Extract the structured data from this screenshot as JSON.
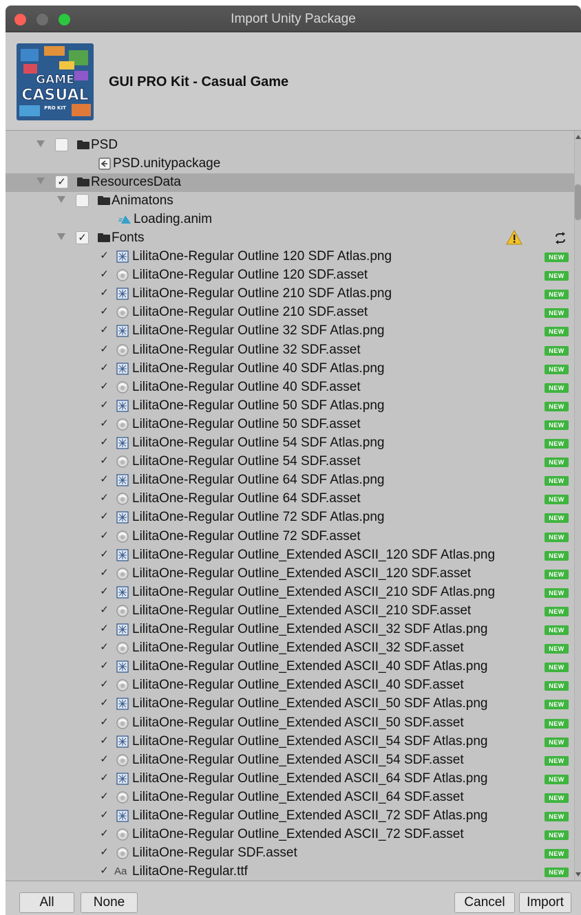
{
  "window": {
    "title": "Import Unity Package"
  },
  "package": {
    "name": "GUI PRO Kit - Casual Game",
    "logo_text": [
      "GAME",
      "CASUAL",
      "PRO KIT"
    ]
  },
  "badges": {
    "new": "NEW"
  },
  "tree": {
    "psd_folder": {
      "label": "PSD",
      "checked": false,
      "icon": "folder-icon"
    },
    "psd_package": {
      "label": "PSD.unitypackage",
      "icon": "unitypackage-icon"
    },
    "resources_folder": {
      "label": "ResourcesData",
      "checked": true,
      "icon": "folder-icon"
    },
    "animations_folder": {
      "label": "Animatons",
      "checked": false,
      "icon": "folder-icon"
    },
    "loading_anim": {
      "label": "Loading.anim",
      "icon": "animation-icon"
    },
    "fonts_folder": {
      "label": "Fonts",
      "checked": true,
      "icon": "folder-icon",
      "status_icons": [
        "warning-icon",
        "refresh-icon"
      ]
    },
    "font_files": [
      {
        "label": "LilitaOne-Regular Outline 120 SDF Atlas.png",
        "icon": "texture-icon",
        "checked": true
      },
      {
        "label": "LilitaOne-Regular Outline 120 SDF.asset",
        "icon": "asset-icon",
        "checked": true
      },
      {
        "label": "LilitaOne-Regular Outline 210 SDF Atlas.png",
        "icon": "texture-icon",
        "checked": true
      },
      {
        "label": "LilitaOne-Regular Outline 210 SDF.asset",
        "icon": "asset-icon",
        "checked": true
      },
      {
        "label": "LilitaOne-Regular Outline 32 SDF Atlas.png",
        "icon": "texture-icon",
        "checked": true
      },
      {
        "label": "LilitaOne-Regular Outline 32 SDF.asset",
        "icon": "asset-icon",
        "checked": true
      },
      {
        "label": "LilitaOne-Regular Outline 40 SDF Atlas.png",
        "icon": "texture-icon",
        "checked": true
      },
      {
        "label": "LilitaOne-Regular Outline 40 SDF.asset",
        "icon": "asset-icon",
        "checked": true
      },
      {
        "label": "LilitaOne-Regular Outline 50 SDF Atlas.png",
        "icon": "texture-icon",
        "checked": true
      },
      {
        "label": "LilitaOne-Regular Outline 50 SDF.asset",
        "icon": "asset-icon",
        "checked": true
      },
      {
        "label": "LilitaOne-Regular Outline 54 SDF Atlas.png",
        "icon": "texture-icon",
        "checked": true
      },
      {
        "label": "LilitaOne-Regular Outline 54 SDF.asset",
        "icon": "asset-icon",
        "checked": true
      },
      {
        "label": "LilitaOne-Regular Outline 64 SDF Atlas.png",
        "icon": "texture-icon",
        "checked": true
      },
      {
        "label": "LilitaOne-Regular Outline 64 SDF.asset",
        "icon": "asset-icon",
        "checked": true
      },
      {
        "label": "LilitaOne-Regular Outline 72 SDF Atlas.png",
        "icon": "texture-icon",
        "checked": true
      },
      {
        "label": "LilitaOne-Regular Outline 72 SDF.asset",
        "icon": "asset-icon",
        "checked": true
      },
      {
        "label": "LilitaOne-Regular Outline_Extended ASCII_120 SDF Atlas.png",
        "icon": "texture-icon",
        "checked": true
      },
      {
        "label": "LilitaOne-Regular Outline_Extended ASCII_120 SDF.asset",
        "icon": "asset-icon",
        "checked": true
      },
      {
        "label": "LilitaOne-Regular Outline_Extended ASCII_210 SDF Atlas.png",
        "icon": "texture-icon",
        "checked": true
      },
      {
        "label": "LilitaOne-Regular Outline_Extended ASCII_210 SDF.asset",
        "icon": "asset-icon",
        "checked": true
      },
      {
        "label": "LilitaOne-Regular Outline_Extended ASCII_32 SDF Atlas.png",
        "icon": "texture-icon",
        "checked": true
      },
      {
        "label": "LilitaOne-Regular Outline_Extended ASCII_32 SDF.asset",
        "icon": "asset-icon",
        "checked": true
      },
      {
        "label": "LilitaOne-Regular Outline_Extended ASCII_40 SDF Atlas.png",
        "icon": "texture-icon",
        "checked": true
      },
      {
        "label": "LilitaOne-Regular Outline_Extended ASCII_40 SDF.asset",
        "icon": "asset-icon",
        "checked": true
      },
      {
        "label": "LilitaOne-Regular Outline_Extended ASCII_50 SDF Atlas.png",
        "icon": "texture-icon",
        "checked": true
      },
      {
        "label": "LilitaOne-Regular Outline_Extended ASCII_50 SDF.asset",
        "icon": "asset-icon",
        "checked": true
      },
      {
        "label": "LilitaOne-Regular Outline_Extended ASCII_54 SDF Atlas.png",
        "icon": "texture-icon",
        "checked": true
      },
      {
        "label": "LilitaOne-Regular Outline_Extended ASCII_54 SDF.asset",
        "icon": "asset-icon",
        "checked": true
      },
      {
        "label": "LilitaOne-Regular Outline_Extended ASCII_64 SDF Atlas.png",
        "icon": "texture-icon",
        "checked": true
      },
      {
        "label": "LilitaOne-Regular Outline_Extended ASCII_64 SDF.asset",
        "icon": "asset-icon",
        "checked": true
      },
      {
        "label": "LilitaOne-Regular Outline_Extended ASCII_72 SDF Atlas.png",
        "icon": "texture-icon",
        "checked": true
      },
      {
        "label": "LilitaOne-Regular Outline_Extended ASCII_72 SDF.asset",
        "icon": "asset-icon",
        "checked": true
      },
      {
        "label": "LilitaOne-Regular SDF.asset",
        "icon": "asset-icon",
        "checked": true
      },
      {
        "label": "LilitaOne-Regular.ttf",
        "icon": "font-icon",
        "checked": true,
        "icon_text": "Aa"
      }
    ]
  },
  "footer": {
    "all_label": "All",
    "none_label": "None",
    "cancel_label": "Cancel",
    "import_label": "Import"
  },
  "colors": {
    "titlebar": "#4f4f4f",
    "panel": "#c4c4c4",
    "selected_row": "#a9a9a9",
    "new_badge": "#3fb43f",
    "warning": "#f2c22b"
  }
}
